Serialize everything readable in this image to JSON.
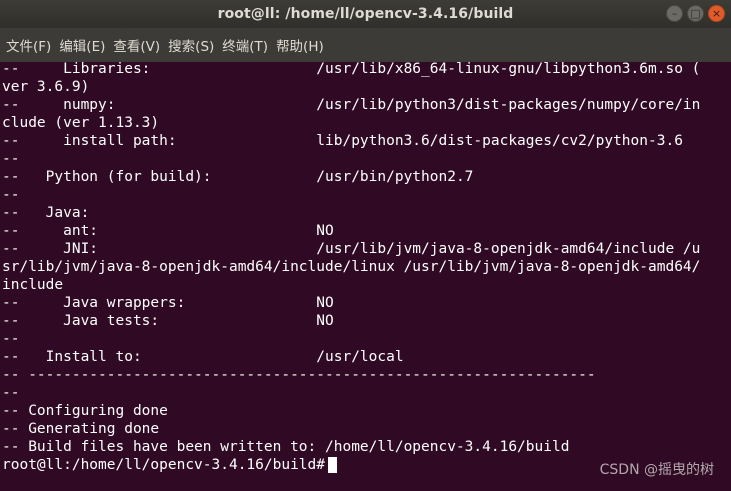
{
  "window": {
    "title": "root@ll: /home/ll/opencv-3.4.16/build",
    "controls": {
      "minimize_glyph": "–",
      "maximize_glyph": "□",
      "close_glyph": "×"
    }
  },
  "menubar": {
    "items": [
      {
        "label": "文件(F)"
      },
      {
        "label": "编辑(E)"
      },
      {
        "label": "查看(V)"
      },
      {
        "label": "搜索(S)"
      },
      {
        "label": "终端(T)"
      },
      {
        "label": "帮助(H)"
      }
    ]
  },
  "terminal": {
    "lines": [
      "--     Libraries:                   /usr/lib/x86_64-linux-gnu/libpython3.6m.so (",
      "ver 3.6.9)",
      "--     numpy:                       /usr/lib/python3/dist-packages/numpy/core/in",
      "clude (ver 1.13.3)",
      "--     install path:                lib/python3.6/dist-packages/cv2/python-3.6",
      "--",
      "--   Python (for build):            /usr/bin/python2.7",
      "--",
      "--   Java:",
      "--     ant:                         NO",
      "--     JNI:                         /usr/lib/jvm/java-8-openjdk-amd64/include /u",
      "sr/lib/jvm/java-8-openjdk-amd64/include/linux /usr/lib/jvm/java-8-openjdk-amd64/",
      "include",
      "--     Java wrappers:               NO",
      "--     Java tests:                  NO",
      "--",
      "--   Install to:                    /usr/local",
      "-- -----------------------------------------------------------------",
      "--",
      "-- Configuring done",
      "-- Generating done",
      "-- Build files have been written to: /home/ll/opencv-3.4.16/build"
    ],
    "prompt": "root@ll:/home/ll/opencv-3.4.16/build#"
  },
  "watermark": {
    "text": "CSDN @摇曳的树"
  },
  "colors": {
    "terminal_bg": "#300a24",
    "terminal_fg": "#ffffff",
    "titlebar_bg": "#3d3c37",
    "close_button": "#e05b2a"
  }
}
